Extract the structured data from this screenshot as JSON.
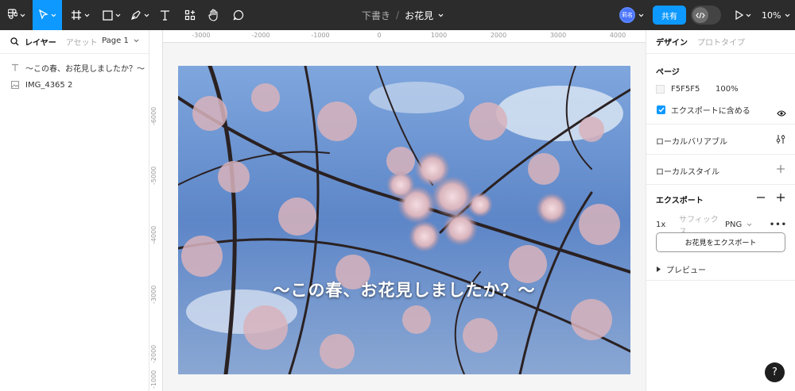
{
  "toolbar": {
    "breadcrumb_draft": "下書き",
    "breadcrumb_sep": "/",
    "file_name": "お花見",
    "avatar_label": "莉名",
    "share_label": "共有",
    "zoom": "10%"
  },
  "left_panel": {
    "tab_layers": "レイヤー",
    "tab_assets": "アセット",
    "page_selector": "Page 1",
    "layers": [
      {
        "icon": "text-icon",
        "label": "〜この春、お花見しましたか？〜"
      },
      {
        "icon": "image-icon",
        "label": "IMG_4365 2"
      }
    ]
  },
  "rulers": {
    "top": [
      "-3000",
      "-2000",
      "-1000",
      "0",
      "1000",
      "2000",
      "3000",
      "4000"
    ],
    "left": [
      "-6000",
      "-5000",
      "-4000",
      "-3000",
      "-2000",
      "-1000"
    ]
  },
  "canvas": {
    "overlay_text": "〜この春、お花見しましたか？〜"
  },
  "right_panel": {
    "tab_design": "デザイン",
    "tab_prototype": "プロトタイプ",
    "page_section_title": "ページ",
    "page_color": "F5F5F5",
    "page_opacity": "100%",
    "include_in_export": "エクスポートに含める",
    "local_variables": "ローカルバリアブル",
    "local_styles": "ローカルスタイル",
    "export_title": "エクスポート",
    "export_scale": "1x",
    "export_suffix_placeholder": "サフィックス",
    "export_format": "PNG",
    "export_button": "お花見をエクスポート",
    "preview": "プレビュー"
  },
  "help_label": "?",
  "colors": {
    "toolbar_bg": "#2c2c2c",
    "accent": "#0d99ff",
    "canvas_bg": "#f5f5f5"
  }
}
